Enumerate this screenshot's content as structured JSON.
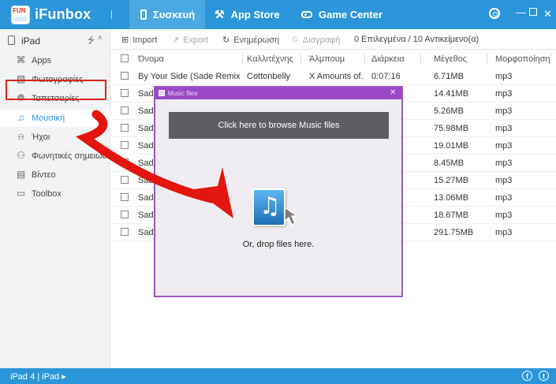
{
  "app": {
    "title": "iFunbox",
    "logo_text": "FUN"
  },
  "top_tabs": [
    {
      "label": "Συσκευή",
      "active": true
    },
    {
      "label": "App Store",
      "active": false
    },
    {
      "label": "Game Center",
      "active": false
    }
  ],
  "sidebar": {
    "device": "iPad",
    "items": [
      {
        "label": "Apps",
        "icon": "apps-icon"
      },
      {
        "label": "Φωτογραφίες",
        "icon": "photos-icon"
      },
      {
        "label": "Ταπετσαρίες",
        "icon": "wallpaper-icon"
      },
      {
        "label": "Μουσική",
        "icon": "music-icon",
        "active": true
      },
      {
        "label": "Ήχοι",
        "icon": "bell-icon"
      },
      {
        "label": "Φωνητικές σημειώσ...",
        "icon": "microphone-icon"
      },
      {
        "label": "Βίντεο",
        "icon": "video-icon"
      },
      {
        "label": "Toolbox",
        "icon": "toolbox-icon"
      }
    ]
  },
  "toolbar": {
    "import_label": "Import",
    "export_label": "Export",
    "refresh_label": "Ενημέρωση",
    "delete_label": "Διαγραφή",
    "status": "0 Επιλεγμένα / 10 Αντικείμενο(α)"
  },
  "table": {
    "headers": [
      "Όνομα",
      "Καλλιτέχνης",
      "Άλμπουμ",
      "Διάρκεια",
      "Μέγεθος",
      "Μορφοποίηση"
    ],
    "rows": [
      [
        "By Your Side (Sade Remix)",
        "Cottonbelly",
        "X Amounts of...",
        "0:07:16",
        "6.71MB",
        "mp3"
      ],
      [
        "Sade",
        "",
        "",
        "",
        "14.41MB",
        "mp3"
      ],
      [
        "Sade",
        "",
        "",
        "",
        "5.26MB",
        "mp3"
      ],
      [
        "Sade",
        "",
        "",
        "",
        "75.98MB",
        "mp3"
      ],
      [
        "Sade",
        "",
        "",
        "",
        "19.01MB",
        "mp3"
      ],
      [
        "Sade",
        "",
        "",
        "",
        "8.45MB",
        "mp3"
      ],
      [
        "Sade",
        "",
        "",
        "",
        "15.27MB",
        "mp3"
      ],
      [
        "Sade",
        "",
        "",
        "",
        "13.06MB",
        "mp3"
      ],
      [
        "Sade",
        "",
        "",
        "",
        "18.67MB",
        "mp3"
      ],
      [
        "Sade",
        "",
        "",
        "",
        "291.75MB",
        "mp3"
      ]
    ]
  },
  "dialog": {
    "title": "Music files",
    "browse_label": "Click here to browse Music files",
    "drop_text": "Or, drop files here."
  },
  "statusbar": {
    "device": "iPad 4 | iPad"
  },
  "colors": {
    "accent": "#2a95d8",
    "dialog_border": "#9b48c8",
    "highlight": "#e2231a"
  }
}
